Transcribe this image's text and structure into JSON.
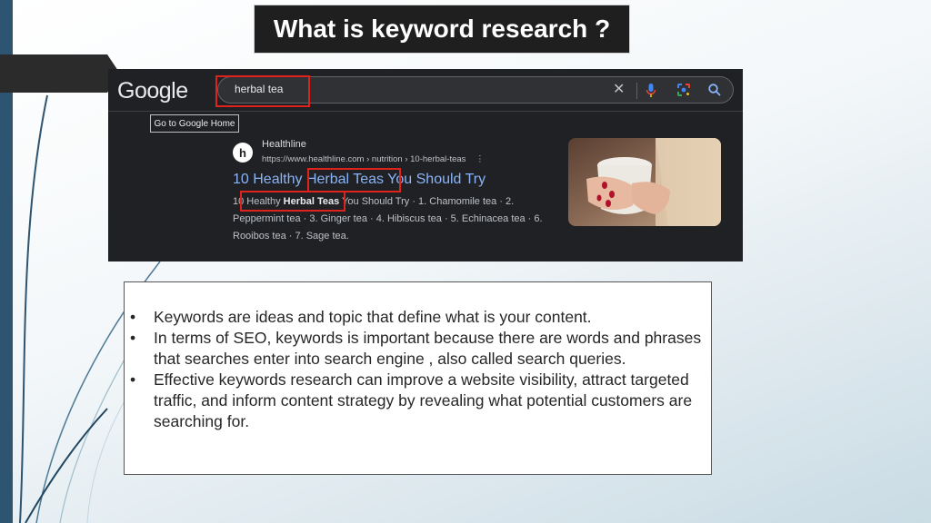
{
  "slide": {
    "title": "What is keyword research ?",
    "bullets": [
      "Keywords are ideas and topic that define what is your content.",
      "In terms of SEO, keywords is important because there are words and phrases that searches enter into search engine , also called search queries.",
      "Effective keywords research can improve a website visibility, attract targeted traffic, and inform content strategy by revealing what potential customers are searching for."
    ],
    "bullet_glyph": "•"
  },
  "screenshot": {
    "logo": "Google",
    "search": {
      "query": "herbal tea"
    },
    "tooltip": "Go to Google Home",
    "result": {
      "favicon_letter": "h",
      "site_name": "Healthline",
      "url": "https://www.healthline.com › nutrition › 10-herbal-teas",
      "more_icon": "⋮",
      "title": "10 Healthy Herbal Teas You Should Try",
      "snippet_prefix": "10 Healthy ",
      "snippet_bold": "Herbal Teas",
      "snippet_rest": " You Should Try · 1. Chamomile tea · 2. Peppermint tea · 3. Ginger tea · 4. Hibiscus tea · 5. Echinacea tea · 6. Rooibos tea · 7. Sage tea."
    },
    "icons": [
      "close-icon",
      "microphone-icon",
      "google-lens-icon",
      "search-icon"
    ],
    "highlight_color": "#e0221c"
  },
  "colors": {
    "accent_bar": "#2d5470",
    "title_bg": "#1f1f1f",
    "link_blue": "#8ab4f8"
  }
}
